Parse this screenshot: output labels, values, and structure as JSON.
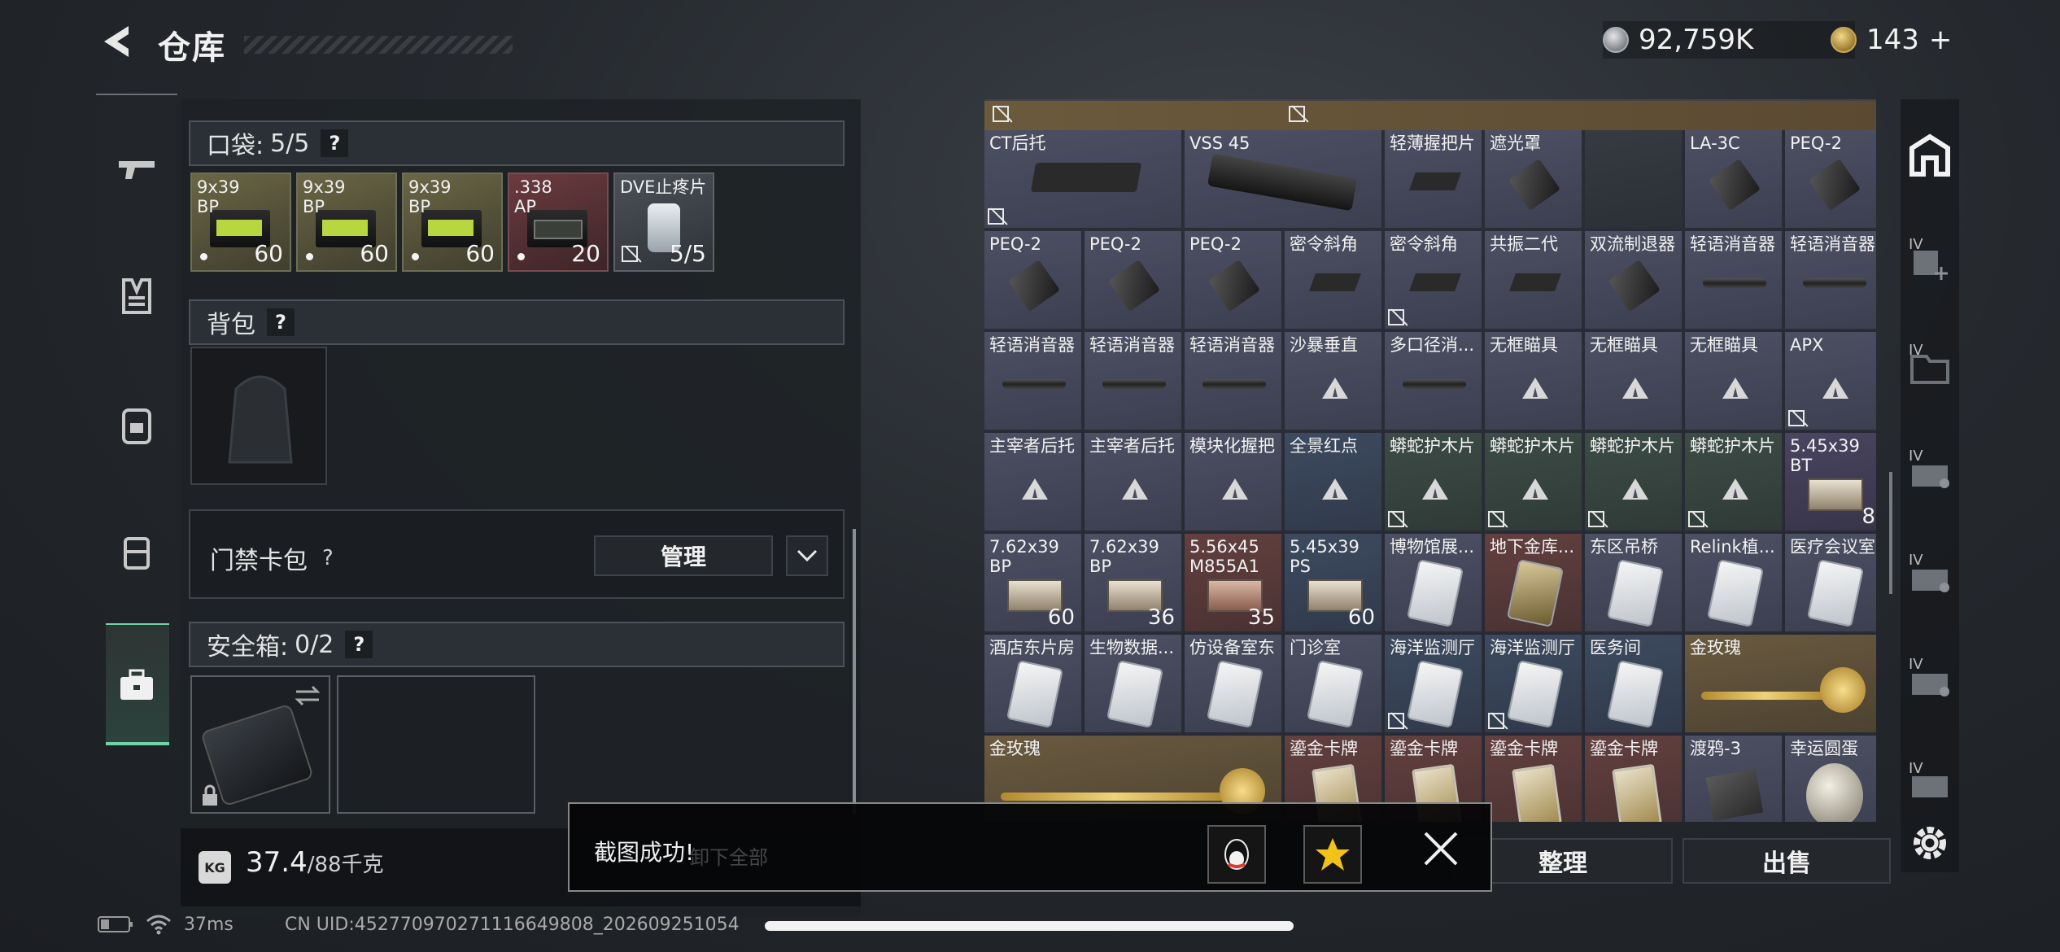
{
  "header": {
    "title": "仓库"
  },
  "currency": {
    "silver": "92,759K",
    "gold": "143",
    "gold_plus": "+"
  },
  "left": {
    "pocket": {
      "label": "口袋:",
      "count": "5/5",
      "help": "?"
    },
    "pocket_items": [
      {
        "name": "9x39\nBP",
        "count": "60"
      },
      {
        "name": "9x39\nBP",
        "count": "60"
      },
      {
        "name": "9x39\nBP",
        "count": "60"
      },
      {
        "name": ".338\nAP",
        "count": "20"
      },
      {
        "name": "DVE止疼片",
        "count": "5/5"
      }
    ],
    "backpack": {
      "label": "背包",
      "help": "?"
    },
    "card_pack": {
      "label": "门禁卡包",
      "help": "?",
      "manage": "管理"
    },
    "safe": {
      "label": "安全箱:",
      "count": "0/2",
      "help": "?"
    },
    "weight": {
      "value": "37.4",
      "max": "/88千克",
      "kg_icon": "KG"
    }
  },
  "grid": {
    "rows": [
      [
        {
          "name": "CT后托",
          "color": "gray",
          "icon": "stock",
          "lock": true
        },
        {
          "name": "VSS 45",
          "color": "gray",
          "icon": "magazine"
        },
        {
          "name": "轻薄握把片",
          "color": "gray",
          "icon": "grip"
        },
        {
          "name": "遮光罩",
          "color": "gray",
          "icon": "scope"
        },
        {
          "name": "",
          "color": "dark",
          "icon": ""
        },
        {
          "name": "LA-3C",
          "color": "gray",
          "icon": "scope"
        },
        {
          "name": "PEQ-2",
          "color": "gray",
          "icon": "scope"
        }
      ],
      [
        {
          "name": "PEQ-2",
          "color": "gray",
          "icon": "scope"
        },
        {
          "name": "PEQ-2",
          "color": "gray",
          "icon": "scope"
        },
        {
          "name": "PEQ-2",
          "color": "gray",
          "icon": "scope"
        },
        {
          "name": "密令斜角",
          "color": "gray",
          "icon": "grip"
        },
        {
          "name": "密令斜角",
          "color": "gray",
          "icon": "grip",
          "lock": true
        },
        {
          "name": "共振二代",
          "color": "gray",
          "icon": "grip"
        },
        {
          "name": "双流制退器",
          "color": "gray",
          "icon": "scope"
        },
        {
          "name": "轻语消音器",
          "color": "gray",
          "icon": "muzzle"
        },
        {
          "name": "轻语消音器",
          "color": "gray",
          "icon": "muzzle"
        }
      ],
      [
        {
          "name": "轻语消音器",
          "color": "gray",
          "icon": "muzzle"
        },
        {
          "name": "轻语消音器",
          "color": "gray",
          "icon": "muzzle"
        },
        {
          "name": "轻语消音器",
          "color": "gray",
          "icon": "muzzle"
        },
        {
          "name": "沙暴垂直",
          "color": "gray",
          "icon": "tri"
        },
        {
          "name": "多口径消...",
          "color": "gray",
          "icon": "muzzle"
        },
        {
          "name": "无框瞄具",
          "color": "gray",
          "icon": "tri"
        },
        {
          "name": "无框瞄具",
          "color": "gray",
          "icon": "tri"
        },
        {
          "name": "无框瞄具",
          "color": "gray",
          "icon": "tri"
        },
        {
          "name": "APX",
          "color": "gray",
          "icon": "tri",
          "lock": true
        }
      ],
      [
        {
          "name": "主宰者后托",
          "color": "gray",
          "icon": "tri"
        },
        {
          "name": "主宰者后托",
          "color": "gray",
          "icon": "tri"
        },
        {
          "name": "模块化握把",
          "color": "gray",
          "icon": "tri"
        },
        {
          "name": "全景红点",
          "color": "blue",
          "icon": "tri"
        },
        {
          "name": "蟒蛇护木片",
          "color": "green",
          "icon": "tri",
          "lock": true
        },
        {
          "name": "蟒蛇护木片",
          "color": "green",
          "icon": "tri",
          "lock": true
        },
        {
          "name": "蟒蛇护木片",
          "color": "green",
          "icon": "tri",
          "lock": true
        },
        {
          "name": "蟒蛇护木片",
          "color": "green",
          "icon": "tri",
          "lock": true
        },
        {
          "name": "5.45x39\nBT",
          "color": "purple",
          "icon": "crate",
          "count": "8"
        }
      ],
      [
        {
          "name": "7.62x39\nBP",
          "color": "gray",
          "icon": "crate",
          "count": "60"
        },
        {
          "name": "7.62x39\nBP",
          "color": "gray",
          "icon": "crate",
          "count": "36"
        },
        {
          "name": "5.56x45\nM855A1",
          "color": "red",
          "icon": "redcrate",
          "count": "35"
        },
        {
          "name": "5.45x39\nPS",
          "color": "blue",
          "icon": "crate",
          "count": "60"
        },
        {
          "name": "博物馆展...",
          "color": "gray",
          "icon": "card"
        },
        {
          "name": "地下金库...",
          "color": "red",
          "icon": "goldcard"
        },
        {
          "name": "东区吊桥",
          "color": "gray",
          "icon": "card"
        },
        {
          "name": "Relink植...",
          "color": "gray",
          "icon": "card"
        },
        {
          "name": "医疗会议室",
          "color": "gray",
          "icon": "card"
        }
      ],
      [
        {
          "name": "酒店东片房",
          "color": "gray",
          "icon": "card"
        },
        {
          "name": "生物数据...",
          "color": "gray",
          "icon": "card"
        },
        {
          "name": "仿设备室东",
          "color": "gray",
          "icon": "card"
        },
        {
          "name": "门诊室",
          "color": "gray",
          "icon": "card"
        },
        {
          "name": "海洋监测厅",
          "color": "blue",
          "icon": "card",
          "lock": true
        },
        {
          "name": "海洋监测厅",
          "color": "blue",
          "icon": "card",
          "lock": true
        },
        {
          "name": "医务间",
          "color": "blue",
          "icon": "card"
        },
        {
          "name": "金玫瑰",
          "color": "gold",
          "icon": "rose",
          "wide": true
        }
      ],
      [
        {
          "name": "金玫瑰",
          "color": "gold",
          "icon": "rose",
          "wide": true
        },
        {
          "name": "鎏金卡牌",
          "color": "red",
          "icon": "tarot"
        },
        {
          "name": "鎏金卡牌",
          "color": "red",
          "icon": "tarot"
        },
        {
          "name": "鎏金卡牌",
          "color": "red",
          "icon": "tarot"
        },
        {
          "name": "鎏金卡牌",
          "color": "red",
          "icon": "tarot"
        },
        {
          "name": "渡鸦-3",
          "color": "gray",
          "icon": "radio"
        },
        {
          "name": "幸运圆蛋",
          "color": "gray",
          "icon": "egg"
        }
      ]
    ],
    "sort_button": "整理",
    "sell_button": "出售"
  },
  "toast": {
    "message": "截图成功!",
    "ghost_text": "卸下全部"
  },
  "status": {
    "ping": "37ms",
    "uid": "CN UID:452770970271116649808_202609251054"
  },
  "right_sidebar": {
    "iv_label": "IV"
  }
}
